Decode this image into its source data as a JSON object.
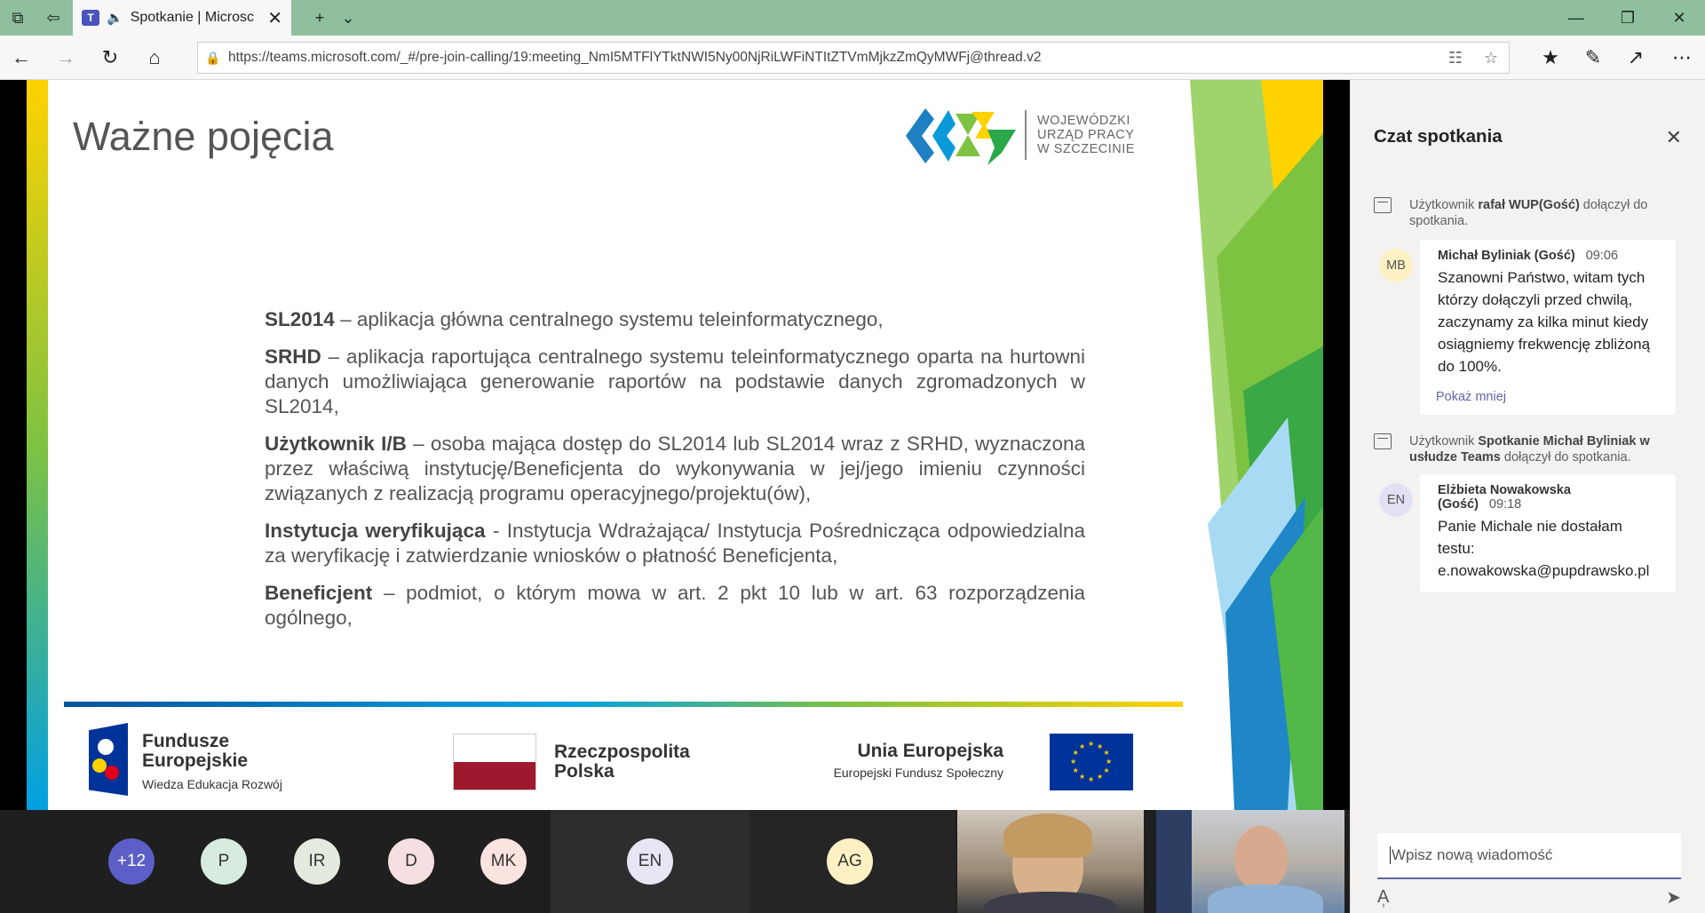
{
  "browser": {
    "tab_title": "Spotkanie | Microsc",
    "url": "https://teams.microsoft.com/_#/pre-join-calling/19:meeting_NmI5MTFlYTktNWI5Ny00NjRiLWFiNTItZTVmMjkzZmQyMWFj@thread.v2"
  },
  "slide": {
    "title": "Ważne pojęcia",
    "logo_lines": [
      "WOJEWÓDZKI",
      "URZĄD PRACY",
      "W  SZCZECINIE"
    ],
    "definitions": [
      {
        "term": "SL2014",
        "text": " – aplikacja główna centralnego systemu teleinformatycznego,"
      },
      {
        "term": "SRHD",
        "text": " – aplikacja raportująca centralnego systemu teleinformatycznego oparta na hurtowni danych umożliwiająca generowanie raportów na podstawie danych zgromadzonych w SL2014,"
      },
      {
        "term": "Użytkownik I/B",
        "text": " – osoba mająca dostęp do SL2014 lub SL2014 wraz z SRHD, wyznaczona przez właściwą instytucję/Beneficjenta do wykonywania w jej/jego imieniu czynności związanych z realizacją programu operacyjnego/projektu(ów),"
      },
      {
        "term": "Instytucja weryfikująca",
        "text": " - Instytucja Wdrażająca/ Instytucja Pośrednicząca odpowiedzialna za weryfikację i zatwierdzanie wniosków o płatność Beneficjenta,"
      },
      {
        "term": "Beneficjent",
        "text": " – podmiot, o którym mowa w art. 2 pkt 10 lub w art. 63 rozporządzenia ogólnego,"
      }
    ],
    "footer": {
      "fe_line1": "Fundusze",
      "fe_line2": "Europejskie",
      "fe_sub": "Wiedza Edukacja Rozwój",
      "pl_line1": "Rzeczpospolita",
      "pl_line2": "Polska",
      "ue_title": "Unia Europejska",
      "ue_sub": "Europejski Fundusz Społeczny"
    }
  },
  "participants": [
    {
      "initials": "+12",
      "color": "#5b5fc7",
      "text_color": "#ffffff"
    },
    {
      "initials": "P",
      "color": "#d7ecdf",
      "text_color": "#333333"
    },
    {
      "initials": "IR",
      "color": "#e5eadf",
      "text_color": "#333333"
    },
    {
      "initials": "D",
      "color": "#f6dfe0",
      "text_color": "#333333"
    },
    {
      "initials": "MK",
      "color": "#fbe3e0",
      "text_color": "#333333"
    },
    {
      "initials": "EN",
      "color": "#e7e6f5",
      "text_color": "#333333"
    },
    {
      "initials": "AG",
      "color": "#fdf1c4",
      "text_color": "#333333"
    }
  ],
  "chat": {
    "title": "Czat spotkania",
    "sys1": {
      "pre": "Użytkownik ",
      "name": "rafał WUP(Gość)",
      "post": " dołączył do spotkania."
    },
    "msg1": {
      "initials": "MB",
      "avatar_color": "#fdf1c4",
      "author": "Michał Byliniak (Gość)",
      "time": "09:06",
      "body": "Szanowni Państwo, witam tych którzy dołączyli przed chwilą, zaczynamy za kilka minut kiedy osiągniemy frekwencję zbliżoną do 100%.",
      "less": "Pokaż mniej"
    },
    "sys2": {
      "pre": "Użytkownik ",
      "name": "Spotkanie Michał Byliniak w usłudze Teams",
      "post": " dołączył do spotkania."
    },
    "msg2": {
      "initials": "EN",
      "avatar_color": "#e2e1f3",
      "author": "Elżbieta Nowakowska (Gość)",
      "time": "09:18",
      "body": "Panie Michale nie dostałam testu: e.nowakowska@pupdrawsko.pl"
    },
    "compose_placeholder": "Wpisz nową wiadomość"
  }
}
